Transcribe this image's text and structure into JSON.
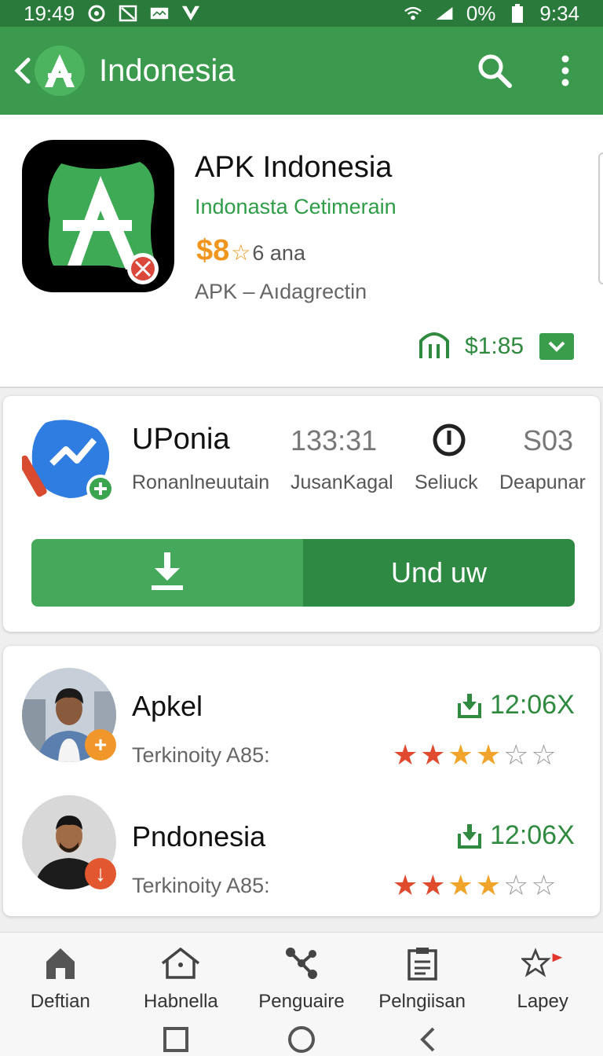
{
  "status": {
    "time_left": "19:49",
    "battery": "0%",
    "time_right": "9:34"
  },
  "appbar": {
    "title": "Indonesia"
  },
  "hero": {
    "app_name": "APK Indonesia",
    "developer": "Indonasta  Cetimerain",
    "price": "$8",
    "age": "6 ana",
    "category": "APK – Aıdagrectin",
    "price_tag": "$1:85"
  },
  "card2": {
    "app_name": "UPonia",
    "subtitle": "Ronanlneuutain",
    "stats": [
      {
        "value": "133:31",
        "label": "JusanKagal"
      },
      {
        "value": "",
        "label": "Seliuck"
      },
      {
        "value": "S03",
        "label": "Deapunar"
      }
    ],
    "install_label": "Und uw"
  },
  "list": [
    {
      "name": "Apkel",
      "sub": "Terkinoity A85:",
      "size": "12:06X",
      "rating": 4,
      "badge": "+"
    },
    {
      "name": "Pndonesia",
      "sub": "Terkinoity A85:",
      "size": "12:06X",
      "rating": 4,
      "badge": "↓"
    }
  ],
  "nav": [
    {
      "label": "Deftian",
      "icon": "home-icon"
    },
    {
      "label": "Habnella",
      "icon": "house-outline-icon"
    },
    {
      "label": "Penguaire",
      "icon": "share-nodes-icon"
    },
    {
      "label": "Pelngiisan",
      "icon": "clipboard-icon"
    },
    {
      "label": "Lapey",
      "icon": "flag-icon"
    }
  ],
  "colors": {
    "primary": "#3c9a4e",
    "dark": "#2a7a3b",
    "accent_orange": "#f0961e",
    "star_red": "#e04a2f"
  }
}
